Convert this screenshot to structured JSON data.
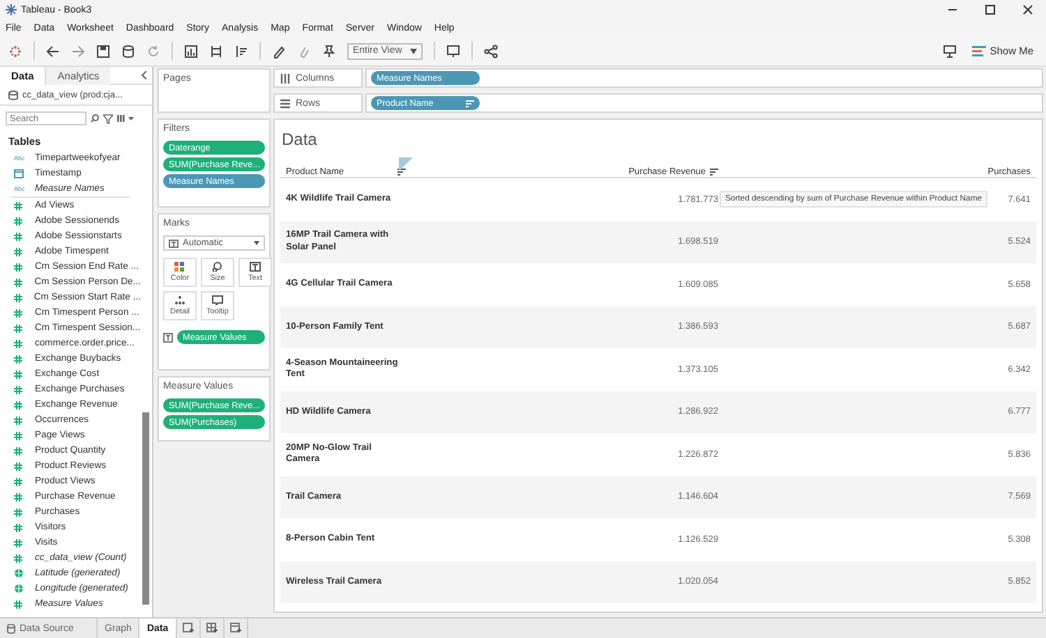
{
  "window": {
    "title": "Tableau - Book3"
  },
  "menu": [
    "File",
    "Data",
    "Worksheet",
    "Dashboard",
    "Story",
    "Analysis",
    "Map",
    "Format",
    "Server",
    "Window",
    "Help"
  ],
  "toolbar": {
    "fit": "Entire View",
    "show_me": "Show Me"
  },
  "data_pane": {
    "tabs": [
      {
        "label": "Data",
        "selected": true
      },
      {
        "label": "Analytics",
        "selected": false
      }
    ],
    "data_source": "cc_data_view (prod:cja...",
    "search": {
      "placeholder": "Search"
    },
    "section": "Tables",
    "fields": [
      {
        "name": "Timepartweekofyear",
        "kind": "string",
        "glyph": "Abc",
        "italic": false
      },
      {
        "name": "Timestamp",
        "kind": "date",
        "italic": false
      },
      {
        "name": "Measure Names",
        "kind": "string",
        "glyph": "Abc",
        "italic": true
      },
      {
        "name": "Ad Views",
        "kind": "measure",
        "italic": false
      },
      {
        "name": "Adobe Sessionends",
        "kind": "measure",
        "italic": false
      },
      {
        "name": "Adobe Sessionstarts",
        "kind": "measure",
        "italic": false
      },
      {
        "name": "Adobe Timespent",
        "kind": "measure",
        "italic": false
      },
      {
        "name": "Cm Session End Rate ...",
        "kind": "measure",
        "italic": false
      },
      {
        "name": "Cm Session Person De...",
        "kind": "measure",
        "italic": false
      },
      {
        "name": "Cm Session Start Rate ...",
        "kind": "measure",
        "italic": false
      },
      {
        "name": "Cm Timespent Person ...",
        "kind": "measure",
        "italic": false
      },
      {
        "name": "Cm Timespent Session...",
        "kind": "measure",
        "italic": false
      },
      {
        "name": "commerce.order.price...",
        "kind": "measure",
        "italic": false
      },
      {
        "name": "Exchange Buybacks",
        "kind": "measure",
        "italic": false
      },
      {
        "name": "Exchange Cost",
        "kind": "measure",
        "italic": false
      },
      {
        "name": "Exchange Purchases",
        "kind": "measure",
        "italic": false
      },
      {
        "name": "Exchange Revenue",
        "kind": "measure",
        "italic": false
      },
      {
        "name": "Occurrences",
        "kind": "measure",
        "italic": false
      },
      {
        "name": "Page Views",
        "kind": "measure",
        "italic": false
      },
      {
        "name": "Product Quantity",
        "kind": "measure",
        "italic": false
      },
      {
        "name": "Product Reviews",
        "kind": "measure",
        "italic": false
      },
      {
        "name": "Product Views",
        "kind": "measure",
        "italic": false
      },
      {
        "name": "Purchase Revenue",
        "kind": "measure",
        "italic": false
      },
      {
        "name": "Purchases",
        "kind": "measure",
        "italic": false
      },
      {
        "name": "Visitors",
        "kind": "measure",
        "italic": false
      },
      {
        "name": "Visits",
        "kind": "measure",
        "italic": false
      },
      {
        "name": "cc_data_view (Count)",
        "kind": "measure",
        "italic": true
      },
      {
        "name": "Latitude (generated)",
        "kind": "geo",
        "italic": true
      },
      {
        "name": "Longitude (generated)",
        "kind": "geo",
        "italic": true
      },
      {
        "name": "Measure Values",
        "kind": "measure",
        "italic": true
      }
    ]
  },
  "cards": {
    "pages": {
      "title": "Pages"
    },
    "filters": {
      "title": "Filters",
      "pills": [
        {
          "label": "Daterange",
          "kind": "measure"
        },
        {
          "label": "SUM(Purchase Reve...",
          "kind": "measure"
        },
        {
          "label": "Measure Names",
          "kind": "dimension"
        }
      ]
    },
    "marks": {
      "title": "Marks",
      "mark_type": "Automatic",
      "buttons": [
        {
          "label": "Color",
          "kind": "color"
        },
        {
          "label": "Size",
          "kind": "size"
        },
        {
          "label": "Text",
          "kind": "text"
        },
        {
          "label": "Detail",
          "kind": "detail"
        },
        {
          "label": "Tooltip",
          "kind": "tooltip"
        }
      ],
      "pills": [
        {
          "label": "Measure Values",
          "kind": "measure"
        }
      ]
    },
    "measure_values": {
      "title": "Measure Values",
      "pills": [
        {
          "label": "SUM(Purchase Reve...",
          "kind": "measure"
        },
        {
          "label": "SUM(Purchases)",
          "kind": "measure"
        }
      ]
    }
  },
  "shelves": [
    {
      "label": "Columns",
      "kind": "columns",
      "pills": [
        {
          "label": "Measure Names",
          "kind": "dimension",
          "sorted": false
        }
      ]
    },
    {
      "label": "Rows",
      "kind": "rows",
      "pills": [
        {
          "label": "Product Name",
          "kind": "dimension",
          "sorted": true
        }
      ]
    }
  ],
  "view": {
    "title": "Data",
    "columns": [
      "Product Name",
      "Purchase Revenue",
      "Purchases"
    ],
    "rows": [
      [
        "4K Wildlife Trail Camera",
        "1.781.773",
        "7.641"
      ],
      [
        "16MP Trail Camera with Solar Panel",
        "1.698.519",
        "5.524"
      ],
      [
        "4G Cellular Trail Camera",
        "1.609.085",
        "5.658"
      ],
      [
        "10-Person Family Tent",
        "1.386.593",
        "5.687"
      ],
      [
        "4-Season Mountaineering Tent",
        "1.373.105",
        "6.342"
      ],
      [
        "HD Wildlife Camera",
        "1.286.922",
        "6.777"
      ],
      [
        "20MP No-Glow Trail Camera",
        "1.226.872",
        "5.836"
      ],
      [
        "Trail Camera",
        "1.146.604",
        "7.569"
      ],
      [
        "8-Person Cabin Tent",
        "1.126.529",
        "5.308"
      ],
      [
        "Wireless Trail Camera",
        "1.020.054",
        "5.852"
      ]
    ],
    "tooltip": "Sorted descending by sum of Purchase Revenue within Product Name"
  },
  "bottom_tabs": [
    {
      "label": "Data Source",
      "kind": "source",
      "selected": false
    },
    {
      "label": "Graph",
      "kind": "sheet",
      "selected": false
    },
    {
      "label": "Data",
      "kind": "sheet",
      "selected": true
    }
  ]
}
